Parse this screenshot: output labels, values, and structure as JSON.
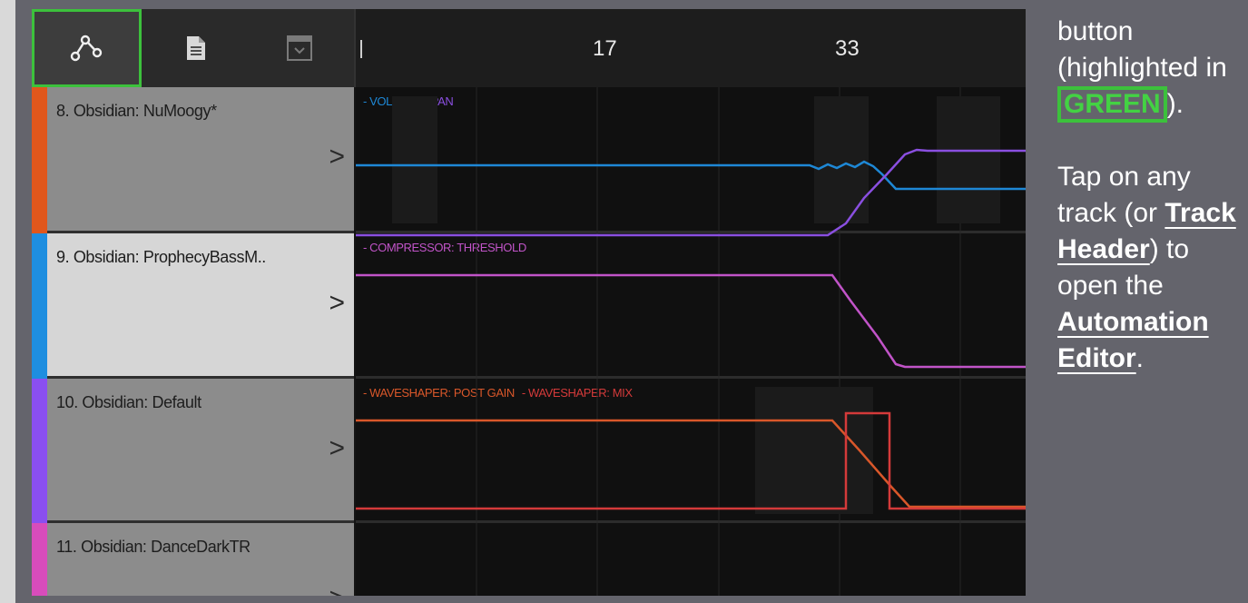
{
  "toolbar": {
    "automation_icon": "automation-nodes-icon",
    "notes_icon": "document-icon",
    "dropdown_icon": "dropdown-box-icon"
  },
  "ruler": {
    "markers": [
      "17",
      "33"
    ]
  },
  "tracks": [
    {
      "name": "8. Obsidian: NuMoogy*",
      "color": "#e0571c",
      "chevron": ">",
      "lanes": [
        "- VOLUME",
        "- PAN"
      ],
      "lane_colors": [
        "#1e88d6",
        "#8a4fe0"
      ]
    },
    {
      "name": "9. Obsidian: ProphecyBassM..",
      "color": "#1e8ee0",
      "chevron": ">",
      "lanes": [
        "- COMPRESSOR: THRESHOLD"
      ],
      "lane_colors": [
        "#c154c8"
      ]
    },
    {
      "name": "10. Obsidian: Default",
      "color": "#8a4ff0",
      "chevron": ">",
      "lanes": [
        "- WAVESHAPER: POST GAIN",
        "- WAVESHAPER: MIX"
      ],
      "lane_colors": [
        "#d9572a",
        "#d43a3a"
      ]
    },
    {
      "name": "11. Obsidian: DanceDarkTR",
      "color": "#d84cbb",
      "chevron": ">",
      "lanes": [],
      "lane_colors": []
    }
  ],
  "instructions": {
    "p1_a": "button (highlighted in ",
    "p1_green": "GREEN",
    "p1_b": ").",
    "p2_a": "Tap on any track (or ",
    "p2_link1": "Track Header",
    "p2_b": ") to open the ",
    "p2_link2": "Automation Editor",
    "p2_c": "."
  },
  "colors": {
    "highlight_green": "#3cc13c",
    "background": "#64646c"
  }
}
